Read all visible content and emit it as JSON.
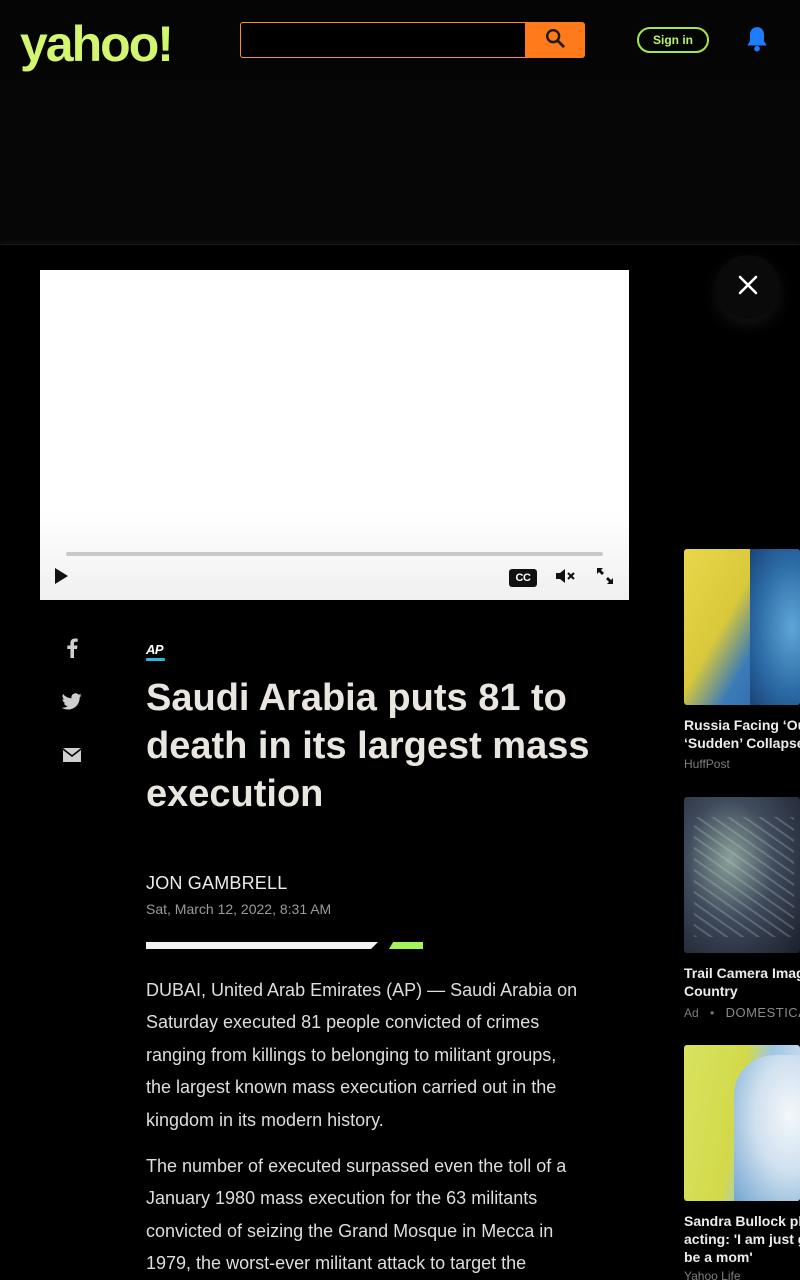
{
  "header": {
    "logo": "yahoo!",
    "search": {
      "value": "",
      "placeholder": ""
    },
    "signin_label": "Sign in",
    "accent_color": "#d4f56f",
    "search_button_color": "#ff7a1a"
  },
  "video": {
    "cc_label": "CC",
    "progress": 0
  },
  "share": [
    "facebook-icon",
    "twitter-icon",
    "mail-icon"
  ],
  "article": {
    "source": "AP",
    "title": "Saudi Arabia puts 81 to death in its largest mass execution",
    "author": "JON GAMBRELL",
    "date": "Sat, March 12, 2022, 8:31 AM",
    "paragraphs": [
      "DUBAI, United Arab Emirates (AP) — Saudi Arabia on Saturday executed 81 people convicted of crimes ranging from killings to belonging to militant groups, the largest known mass execution carried out in the kingdom in its modern history.",
      "The number of executed surpassed even the toll of a January 1980 mass execution for the 63 militants convicted of seizing the Grand Mosque in Mecca in 1979, the worst-ever militant attack to target the"
    ]
  },
  "sidebar": {
    "cards": [
      {
        "title_line1": "Russia Facing ‘Ou",
        "title_line2": "‘Sudden’ Collapse",
        "source": "HuffPost",
        "is_ad": false
      },
      {
        "title_line1": "Trail Camera Imag",
        "title_line2": "Country",
        "source": "DOMESTICA",
        "ad_label": "Ad",
        "is_ad": true
      },
      {
        "title_line1": "Sandra Bullock pl",
        "title_line2": "acting: 'I am just g",
        "title_line3": "be a mom'",
        "source": "Yahoo Life",
        "is_ad": false
      }
    ]
  }
}
